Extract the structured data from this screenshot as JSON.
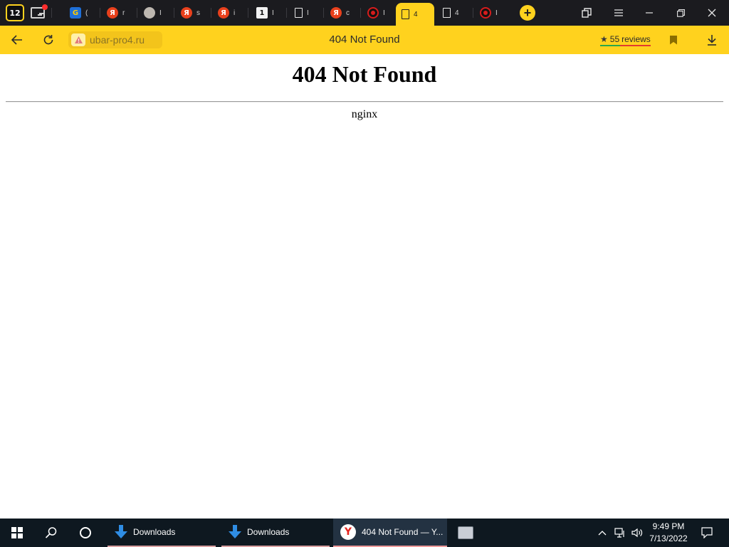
{
  "browser": {
    "tab_count": "12",
    "tabs": [
      {
        "favicon": "google-icon",
        "favicon_text": "G",
        "title": "("
      },
      {
        "favicon": "yandex-icon",
        "favicon_text": "Я",
        "title": "r"
      },
      {
        "favicon": "avatar-icon",
        "favicon_text": "",
        "title": "I"
      },
      {
        "favicon": "yandex-icon",
        "favicon_text": "Я",
        "title": "s"
      },
      {
        "favicon": "yandex-icon",
        "favicon_text": "Я",
        "title": "i"
      },
      {
        "favicon": "number-icon",
        "favicon_text": "1",
        "title": "I"
      },
      {
        "favicon": "document-icon",
        "favicon_text": "",
        "title": "I"
      },
      {
        "favicon": "yandex-icon",
        "favicon_text": "Я",
        "title": "c"
      },
      {
        "favicon": "record-icon",
        "favicon_text": "",
        "title": "I"
      },
      {
        "favicon": "document-icon",
        "favicon_text": "",
        "title": "4",
        "active": true
      },
      {
        "favicon": "document-icon",
        "favicon_text": "",
        "title": "4"
      },
      {
        "favicon": "record-icon",
        "favicon_text": "",
        "title": "I"
      }
    ],
    "new_tab_symbol": "+",
    "address_bar": {
      "url": "ubar-pro4.ru",
      "title": "404 Not Found",
      "reviews_count": "55",
      "reviews_label": "reviews"
    }
  },
  "page": {
    "heading": "404 Not Found",
    "server": "nginx"
  },
  "taskbar": {
    "items": [
      {
        "label": "Downloads",
        "icon": "download-folder-icon"
      },
      {
        "label": "Downloads",
        "icon": "download-folder-icon"
      },
      {
        "label": "404 Not Found — Y...",
        "icon": "yandex-browser-icon",
        "active": true
      },
      {
        "label": "",
        "icon": "printer-icon"
      }
    ],
    "clock": {
      "time": "9:49 PM",
      "date": "7/13/2022"
    }
  },
  "colors": {
    "accent_yellow": "#ffd21e",
    "tabstrip_bg": "#1b1b1f",
    "taskbar_bg": "#0e1820"
  }
}
